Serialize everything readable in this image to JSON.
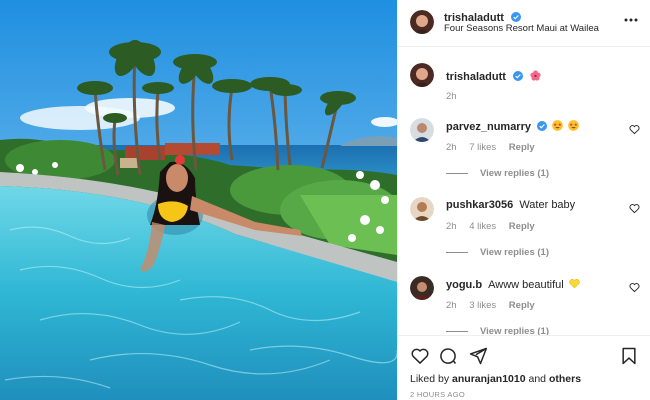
{
  "header": {
    "username": "trishaladutt",
    "location": "Four Seasons Resort Maui at Wailea",
    "more_icon": "more-horizontal-icon"
  },
  "caption": {
    "username": "trishaladutt",
    "emoji": "hibiscus",
    "time": "2h"
  },
  "comments": [
    {
      "username": "parvez_numarry",
      "verified": true,
      "text": "",
      "emoji": [
        "star-struck",
        "star-struck"
      ],
      "time": "2h",
      "likes": "7 likes",
      "reply": "Reply",
      "view_replies": "View replies (1)"
    },
    {
      "username": "pushkar3056",
      "verified": false,
      "text": "Water baby",
      "emoji": [],
      "time": "2h",
      "likes": "4 likes",
      "reply": "Reply",
      "view_replies": "View replies (1)"
    },
    {
      "username": "yogu.b",
      "verified": false,
      "text": "Awww beautiful",
      "emoji": [
        "yellow-heart"
      ],
      "time": "2h",
      "likes": "3 likes",
      "reply": "Reply",
      "view_replies": "View replies (1)"
    }
  ],
  "actions": {
    "liked_prefix": "Liked by",
    "liked_user": "anuranjan1010",
    "liked_and": "and",
    "liked_others": "others",
    "timestamp": "2 HOURS AGO",
    "icons": [
      "heart-icon",
      "comment-icon",
      "share-icon",
      "bookmark-icon"
    ]
  },
  "colors": {
    "verified": "#3897f0",
    "muted": "#8e8e8e",
    "text": "#262626"
  }
}
